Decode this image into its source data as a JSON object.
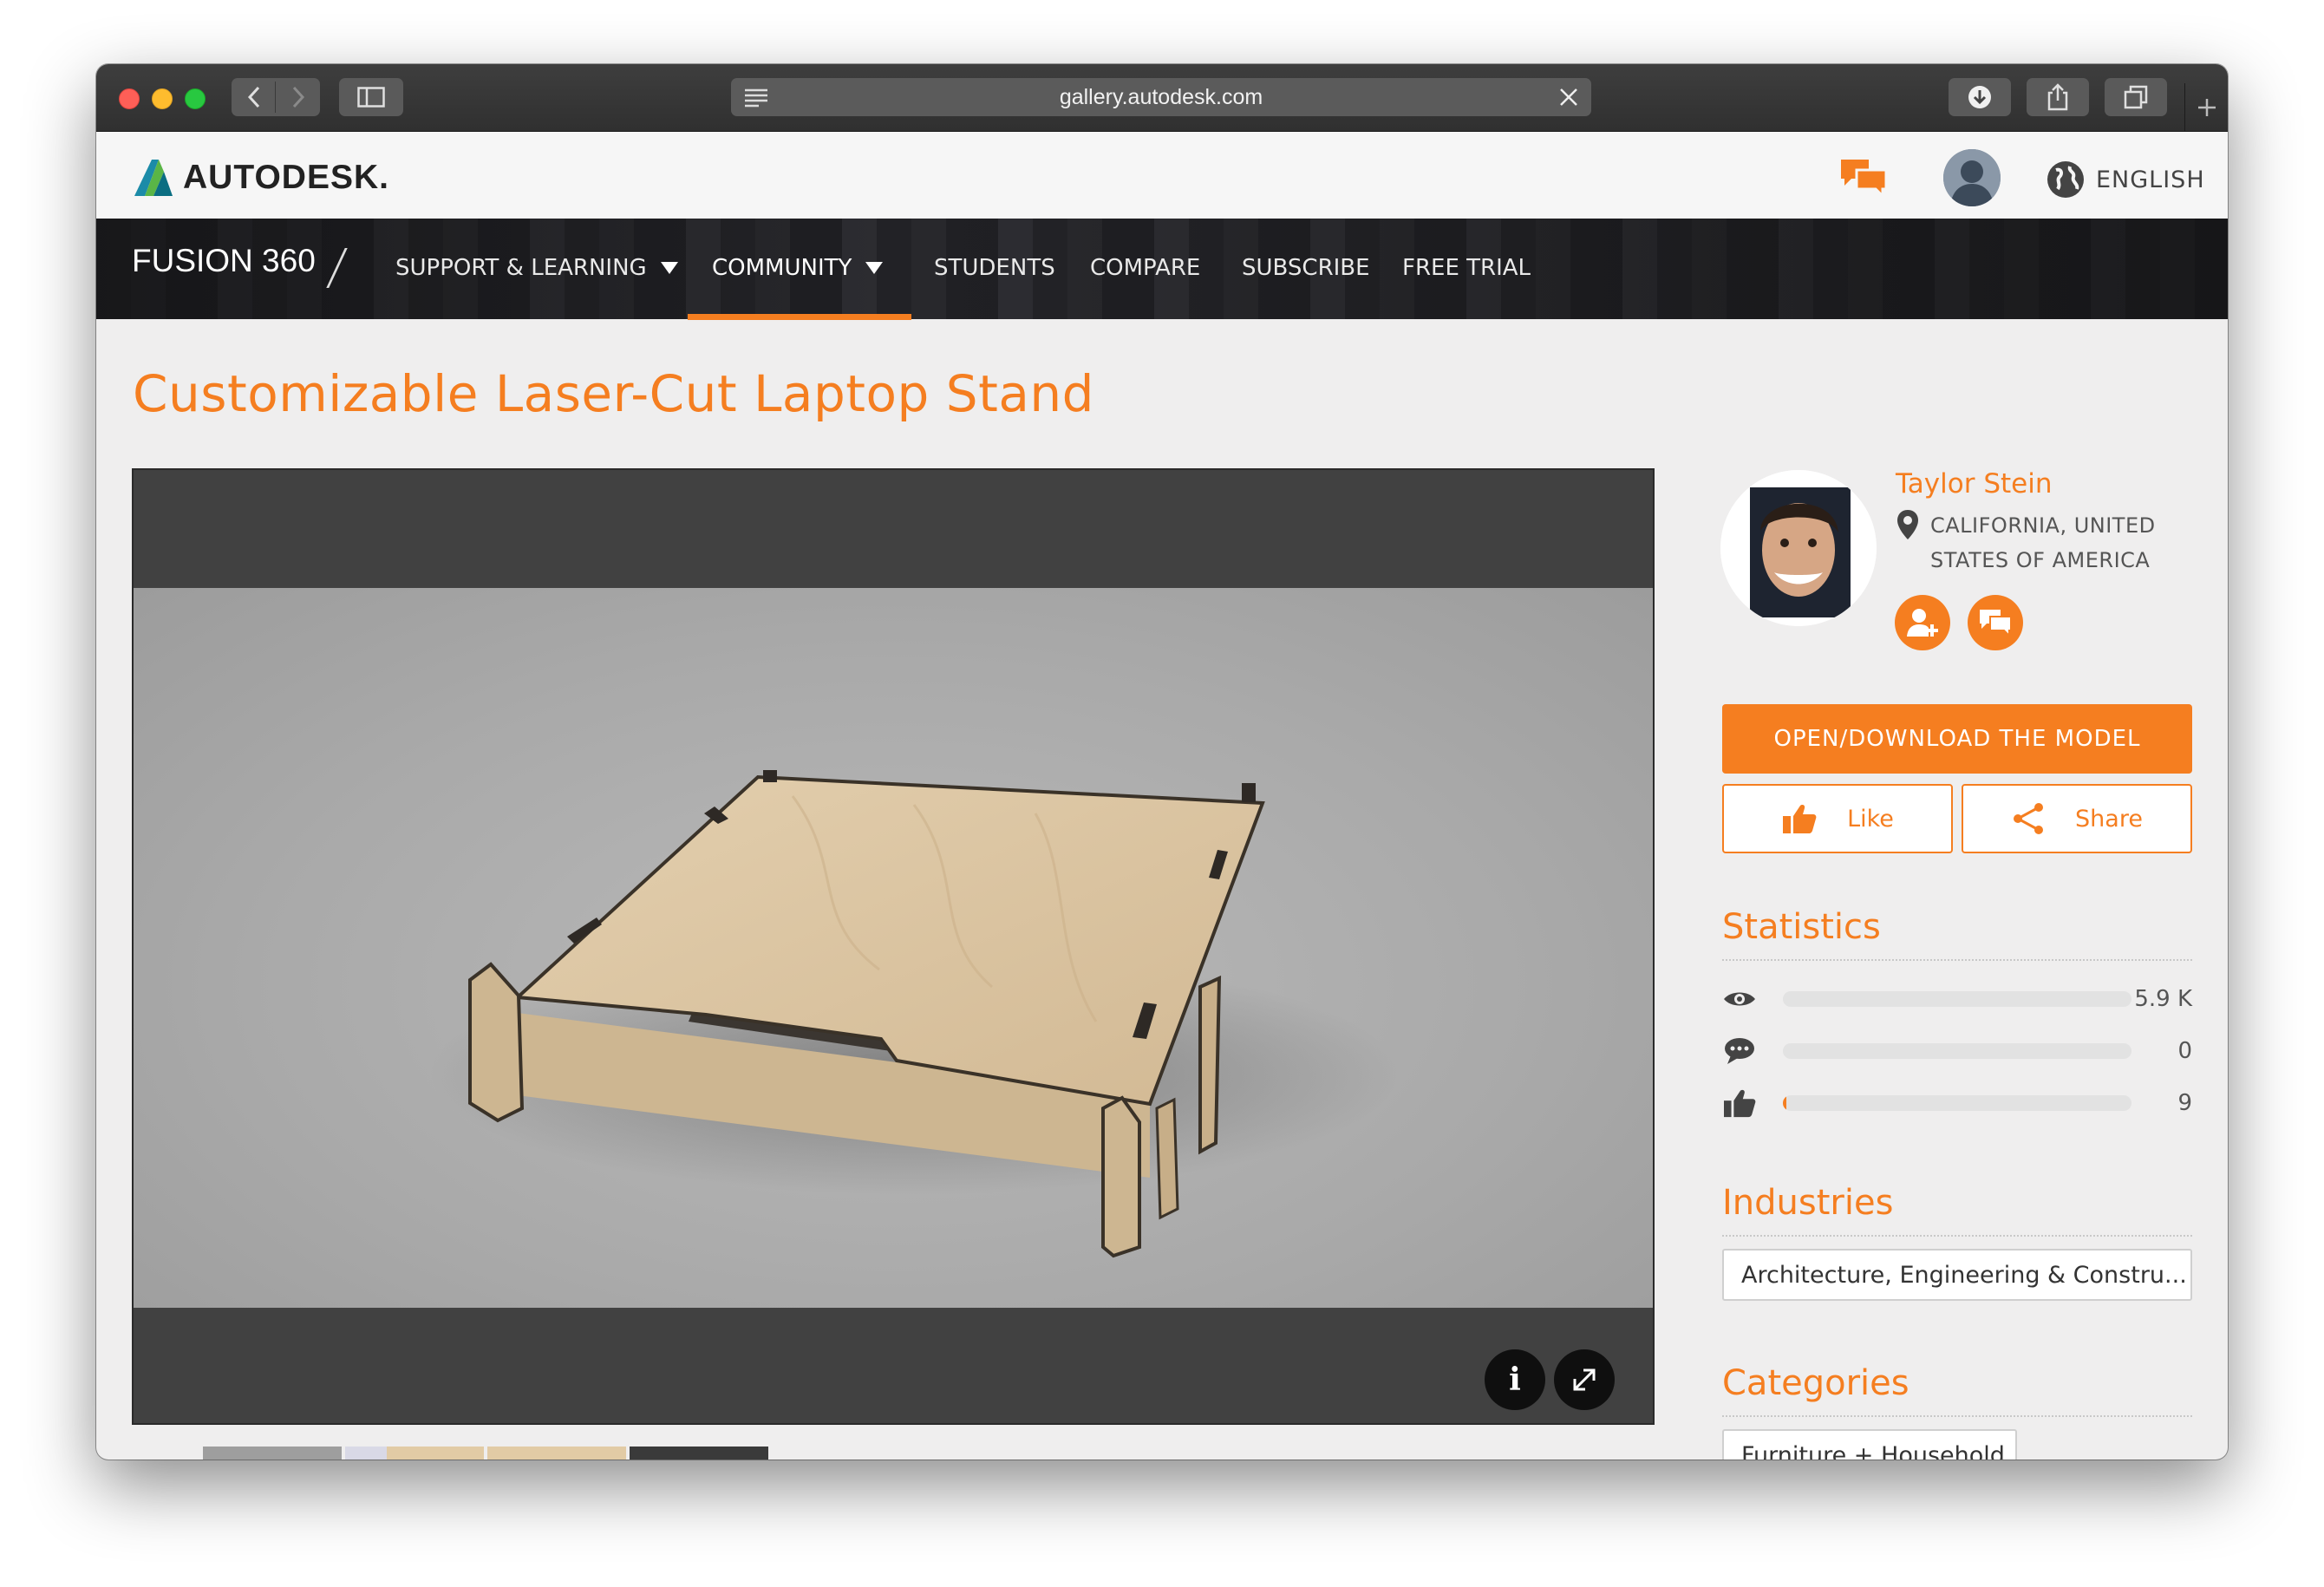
{
  "browser": {
    "url": "gallery.autodesk.com"
  },
  "header": {
    "logo_text": "AUTODESK.",
    "language": "ENGLISH",
    "icons": [
      "chat-icon",
      "user-avatar",
      "globe-icon"
    ]
  },
  "product_nav": {
    "product": "FUSION 360",
    "items": [
      {
        "label": "SUPPORT & LEARNING",
        "dropdown": true
      },
      {
        "label": "COMMUNITY",
        "dropdown": true,
        "active": true
      },
      {
        "label": "STUDENTS"
      },
      {
        "label": "COMPARE"
      },
      {
        "label": "SUBSCRIBE"
      },
      {
        "label": "FREE TRIAL"
      }
    ]
  },
  "page": {
    "title": "Customizable Laser-Cut Laptop Stand"
  },
  "viewer": {
    "info_label": "i",
    "icons": [
      "info-icon",
      "fullscreen-icon"
    ]
  },
  "author": {
    "name": "Taylor Stein",
    "location": "CALIFORNIA, UNITED STATES OF AMERICA"
  },
  "actions": {
    "open_download": "OPEN/DOWNLOAD THE MODEL",
    "like": "Like",
    "share": "Share"
  },
  "statistics": {
    "title": "Statistics",
    "rows": [
      {
        "icon": "eye-icon",
        "value": "5.9 K",
        "fill": 0
      },
      {
        "icon": "comment-icon",
        "value": "0",
        "fill": 0
      },
      {
        "icon": "thumbs-up-icon",
        "value": "9",
        "fill": 0.01
      }
    ]
  },
  "industries": {
    "title": "Industries",
    "tag": "Architecture, Engineering & Constru..."
  },
  "categories": {
    "title": "Categories",
    "tag": "Furniture + Household"
  },
  "colors": {
    "accent": "#f57e20",
    "nav_bg": "#2b2b2f",
    "viewer_bg": "#414141"
  }
}
